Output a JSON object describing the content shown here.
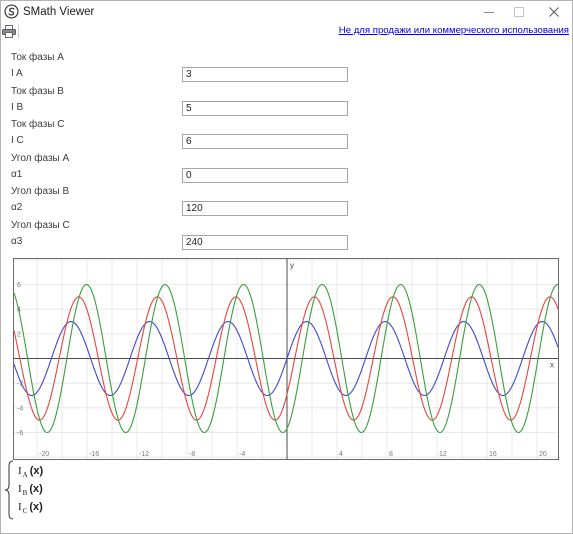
{
  "window": {
    "title": "SMath Viewer"
  },
  "icons": {
    "app": "smath-logo-icon",
    "print": "print-icon",
    "minimize": "minimize-icon",
    "maximize": "maximize-icon",
    "close": "close-icon"
  },
  "toolbar": {
    "license_link": "Не для продажи или коммерческого использования"
  },
  "form": {
    "fields": [
      {
        "group": "Ток фазы А",
        "var": "I A",
        "value": "3"
      },
      {
        "group": "Ток фазы В",
        "var": "I B",
        "value": "5"
      },
      {
        "group": "Ток фазы С",
        "var": "I C",
        "value": "6"
      },
      {
        "group": "Угол фазы А",
        "var": "α1",
        "value": "0"
      },
      {
        "group": "Угол фазы В",
        "var": "α2",
        "value": "120"
      },
      {
        "group": "Угол фазы С",
        "var": "α3",
        "value": "240"
      }
    ]
  },
  "colors": {
    "link": "#0000e6",
    "plot_border": "#6b6b6b"
  },
  "chart_data": {
    "type": "line",
    "xlabel": "x",
    "ylabel": "y",
    "xlim": [
      -21.84,
      21.68
    ],
    "ylim": [
      -8.15,
      8.07
    ],
    "grid": true,
    "x_ticks": [
      -20,
      -16,
      -12,
      -8,
      -4,
      4,
      8,
      12,
      16,
      20
    ],
    "y_ticks": [
      6,
      4,
      2,
      -2,
      -4,
      -6
    ],
    "series": [
      {
        "label": {
          "base": "I",
          "sub": "A",
          "arg": "(x)"
        },
        "amplitude": 3,
        "phase": 0,
        "color": "#4049d0"
      },
      {
        "label": {
          "base": "I",
          "sub": "B",
          "arg": "(x)"
        },
        "amplitude": 5,
        "phase": 120,
        "color": "#e2473d"
      },
      {
        "label": {
          "base": "I",
          "sub": "C",
          "arg": "(x)"
        },
        "amplitude": 6,
        "phase": 240,
        "color": "#3a9f3c"
      }
    ]
  }
}
